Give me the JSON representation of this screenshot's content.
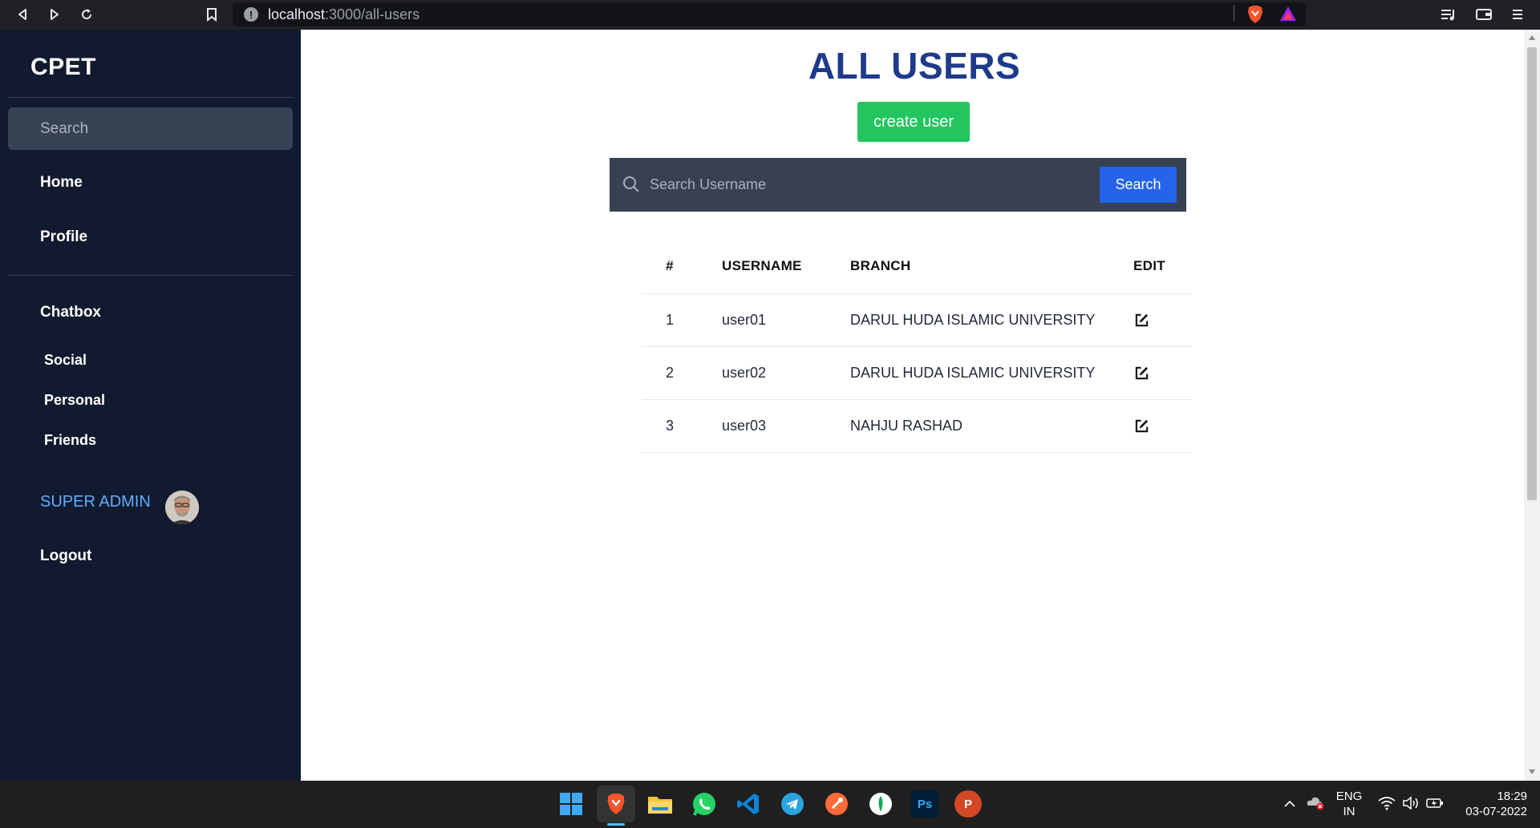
{
  "browser": {
    "url_host": "localhost",
    "url_path": ":3000/all-users"
  },
  "sidebar": {
    "brand": "CPET",
    "search_placeholder": "Search",
    "nav": [
      {
        "label": "Home"
      },
      {
        "label": "Profile"
      }
    ],
    "chatbox_label": "Chatbox",
    "chat_items": [
      {
        "label": "Social"
      },
      {
        "label": "Personal"
      },
      {
        "label": "Friends"
      }
    ],
    "admin_label": "SUPER ADMIN",
    "logout_label": "Logout"
  },
  "main": {
    "title": "ALL USERS",
    "create_button": "create user",
    "search_placeholder": "Search Username",
    "search_button": "Search",
    "table": {
      "headers": [
        "#",
        "USERNAME",
        "BRANCH",
        "EDIT"
      ],
      "rows": [
        {
          "num": "1",
          "username": "user01",
          "branch": "DARUL HUDA ISLAMIC UNIVERSITY"
        },
        {
          "num": "2",
          "username": "user02",
          "branch": "DARUL HUDA ISLAMIC UNIVERSITY"
        },
        {
          "num": "3",
          "username": "user03",
          "branch": "NAHJU RASHAD"
        }
      ]
    }
  },
  "taskbar": {
    "apps": [
      "windows-start-icon",
      "brave-icon",
      "file-explorer-icon",
      "whatsapp-icon",
      "vscode-icon",
      "telegram-icon",
      "postman-icon",
      "mongodb-compass-icon",
      "photoshop-icon",
      "powerpoint-icon"
    ],
    "photoshop_label": "Ps",
    "powerpoint_label": "P",
    "lang_line1": "ENG",
    "lang_line2": "IN",
    "time": "18:29",
    "date": "03-07-2022"
  },
  "colors": {
    "sidebar_bg": "#111a2e",
    "title": "#1e3a8a",
    "create_button": "#22c55e",
    "search_button": "#2563eb",
    "admin_label": "#5eb0ff"
  }
}
